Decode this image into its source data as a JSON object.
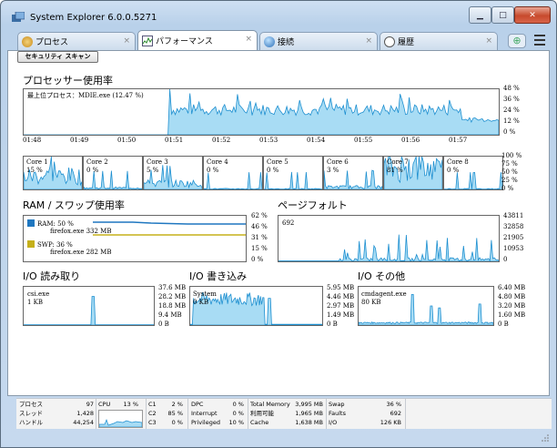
{
  "window": {
    "title": "System Explorer 6.0.0.5271"
  },
  "tabs": [
    {
      "label": "プロセス",
      "icon": "process-icon",
      "active": false
    },
    {
      "label": "パフォーマンス",
      "icon": "performance-icon",
      "active": true
    },
    {
      "label": "接続",
      "icon": "connections-icon",
      "active": false
    },
    {
      "label": "履歴",
      "icon": "history-icon",
      "active": false
    }
  ],
  "toolbar": {
    "security_scan": "セキュリティ スキャン"
  },
  "cpu_usage": {
    "title": "プロセッサー使用率",
    "top_process": "最上位プロセス：MDIE.exe (12.47 %)",
    "y_ticks": [
      "48 %",
      "36 %",
      "24 %",
      "12 %",
      "0 %"
    ],
    "x_ticks": [
      "01:48",
      "01:49",
      "01:50",
      "01:51",
      "01:52",
      "01:53",
      "01:54",
      "01:55",
      "01:56",
      "01:57"
    ]
  },
  "cores": {
    "items": [
      {
        "name": "Core 1",
        "value": "15 %"
      },
      {
        "name": "Core 2",
        "value": "0 %"
      },
      {
        "name": "Core 3",
        "value": "5 %"
      },
      {
        "name": "Core 4",
        "value": "0 %"
      },
      {
        "name": "Core 5",
        "value": "0 %"
      },
      {
        "name": "Core 6",
        "value": "3 %"
      },
      {
        "name": "Core 7",
        "value": "81 %"
      },
      {
        "name": "Core 8",
        "value": "0 %"
      }
    ],
    "y_ticks": [
      "100 %",
      "75 %",
      "50 %",
      "25 %",
      "0 %"
    ]
  },
  "ram": {
    "title": "RAM / スワップ使用率",
    "ram_label": "RAM: 50 %",
    "ram_proc": "firefox.exe 332 MB",
    "swp_label": "SWP: 36 %",
    "swp_proc": "firefox.exe 282 MB",
    "ram_color": "#1f77c0",
    "swp_color": "#c5b01a",
    "y_ticks": [
      "62 %",
      "46 %",
      "31 %",
      "15 %",
      "0 %"
    ]
  },
  "page_faults": {
    "title": "ページフォルト",
    "current": "692",
    "y_ticks": [
      "43811",
      "32858",
      "21905",
      "10953",
      "0"
    ]
  },
  "io_read": {
    "title": "I/O 読み取り",
    "proc": "csi.exe",
    "value": "1 KB",
    "y_ticks": [
      "37.6 MB",
      "28.2 MB",
      "18.8 MB",
      "9.4 MB",
      "0 B"
    ]
  },
  "io_write": {
    "title": "I/O 書き込み",
    "proc": "System",
    "value": "0 KB",
    "y_ticks": [
      "5.95 MB",
      "4.46 MB",
      "2.97 MB",
      "1.49 MB",
      "0 B"
    ]
  },
  "io_other": {
    "title": "I/O その他",
    "proc": "cmdagent.exe",
    "value": "80 KB",
    "y_ticks": [
      "6.40 MB",
      "4.80 MB",
      "3.20 MB",
      "1.60 MB",
      "0 B"
    ]
  },
  "status": {
    "col1": [
      {
        "k": "プロセス",
        "v": "97"
      },
      {
        "k": "スレッド",
        "v": "1,428"
      },
      {
        "k": "ハンドル",
        "v": "44,254"
      }
    ],
    "cpu": {
      "k": "CPU",
      "v": "13 %"
    },
    "col3": [
      {
        "k": "C1",
        "v": "2 %"
      },
      {
        "k": "C2",
        "v": "85 %"
      },
      {
        "k": "C3",
        "v": "0 %"
      }
    ],
    "col4": [
      {
        "k": "DPC",
        "v": "0 %"
      },
      {
        "k": "Interrupt",
        "v": "0 %"
      },
      {
        "k": "Privileged",
        "v": "10 %"
      }
    ],
    "col5": [
      {
        "k": "Total Memory",
        "v": "3,995 MB"
      },
      {
        "k": "利用可能",
        "v": "1,965 MB"
      },
      {
        "k": "Cache",
        "v": "1,638 MB"
      }
    ],
    "col6": [
      {
        "k": "Swap",
        "v": "36 %"
      },
      {
        "k": "Faults",
        "v": "692"
      },
      {
        "k": "I/O",
        "v": "126 KB"
      }
    ]
  },
  "colors": {
    "graph_fill": "#a8dcf4",
    "graph_line": "#1d8fd0"
  }
}
